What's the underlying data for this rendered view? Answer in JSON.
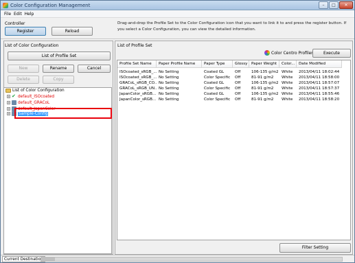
{
  "window": {
    "title": "Color Configuration Management"
  },
  "menu": [
    "File",
    "Edit",
    "Help"
  ],
  "controller": {
    "label": "Controller",
    "register": "Register",
    "reload": "Reload"
  },
  "info_text": "Drag-and-drop the Profile Set to the Color Configuration icon that you want to link it to and press the register button. If you select a Color Configuration, you can view the detailed information.",
  "left": {
    "label": "List of Color Configuration",
    "buttons": {
      "list_profile_set": "List of Profile Set",
      "new": "New",
      "rename": "Rename",
      "cancel": "Cancel",
      "delete": "Delete",
      "copy": "Copy"
    },
    "tree": {
      "root": "List of Color Configuration",
      "items": [
        "default_ISOcoated",
        "default_GRACoL",
        "default_JapanColor",
        "Sample-Config"
      ]
    }
  },
  "right": {
    "label": "List of Profile Set",
    "centro_label": "Color Centro Profiler :",
    "execute": "Execute",
    "filter": "Filter Setting",
    "columns": [
      "Profile Set Name",
      "Paper Profile Name",
      "Paper Type",
      "Glossy",
      "Paper Weight",
      "Color...",
      "Date Modified"
    ],
    "rows": [
      [
        "ISOcoated_sRGB_...",
        "No Setting",
        "Coated GL",
        "Off",
        "106-135 g/m2",
        "White",
        "2013/04/11 18:02:44"
      ],
      [
        "ISOcoated_sRGB_...",
        "No Setting",
        "Color Specific",
        "Off",
        "81-91 g/m2",
        "White",
        "2013/04/11 18:58:00"
      ],
      [
        "GRACoL_sRGB_CO...",
        "No Setting",
        "Coated GL",
        "Off",
        "106-135 g/m2",
        "White",
        "2013/04/11 18:57:07"
      ],
      [
        "GRACoL_sRGB_UN...",
        "No Setting",
        "Color Specific",
        "Off",
        "81-91 g/m2",
        "White",
        "2013/04/11 18:57:37"
      ],
      [
        "JapanColor_sRGB...",
        "No Setting",
        "Coated GL",
        "Off",
        "106-135 g/m2",
        "White",
        "2013/04/11 18:55:46"
      ],
      [
        "JapanColor_sRGB...",
        "No Setting",
        "Color Specific",
        "Off",
        "81-91 g/m2",
        "White",
        "2013/04/11 18:58:20"
      ]
    ]
  },
  "status": {
    "tab": "Current Destination"
  },
  "colors": {
    "highlight": "#e8000b",
    "selection": "#3399ff",
    "tree_red": "#e00000"
  },
  "icons": [
    "app-icon",
    "folder-icon",
    "check-icon",
    "config-icon",
    "palette-icon"
  ]
}
